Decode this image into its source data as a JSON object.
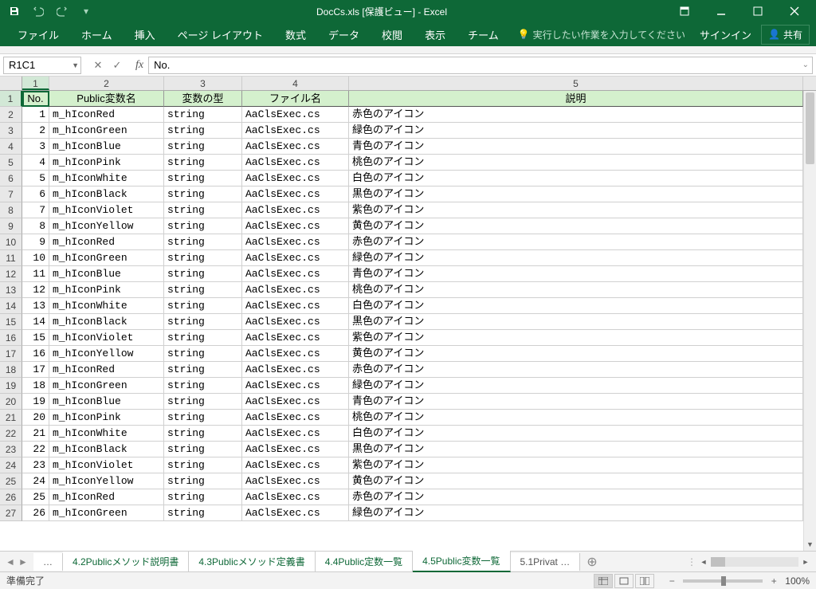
{
  "title": "DocCs.xls  [保護ビュー] - Excel",
  "ribbon": {
    "file": "ファイル",
    "home": "ホーム",
    "insert": "挿入",
    "pagelayout": "ページ レイアウト",
    "formulas": "数式",
    "data": "データ",
    "review": "校閲",
    "view": "表示",
    "team": "チーム",
    "tell": "実行したい作業を入力してください",
    "signin": "サインイン",
    "share": "共有"
  },
  "name_box": "R1C1",
  "formula": "No.",
  "col_headers": [
    "1",
    "2",
    "3",
    "4",
    "5"
  ],
  "headers": {
    "c1": "No.",
    "c2": "Public変数名",
    "c3": "変数の型",
    "c4": "ファイル名",
    "c5": "説明"
  },
  "rows": [
    {
      "n": "1",
      "v": "m_hIconRed",
      "t": "string",
      "f": "AaClsExec.cs",
      "d": "赤色のアイコン"
    },
    {
      "n": "2",
      "v": "m_hIconGreen",
      "t": "string",
      "f": "AaClsExec.cs",
      "d": "緑色のアイコン"
    },
    {
      "n": "3",
      "v": "m_hIconBlue",
      "t": "string",
      "f": "AaClsExec.cs",
      "d": "青色のアイコン"
    },
    {
      "n": "4",
      "v": "m_hIconPink",
      "t": "string",
      "f": "AaClsExec.cs",
      "d": "桃色のアイコン"
    },
    {
      "n": "5",
      "v": "m_hIconWhite",
      "t": "string",
      "f": "AaClsExec.cs",
      "d": "白色のアイコン"
    },
    {
      "n": "6",
      "v": "m_hIconBlack",
      "t": "string",
      "f": "AaClsExec.cs",
      "d": "黒色のアイコン"
    },
    {
      "n": "7",
      "v": "m_hIconViolet",
      "t": "string",
      "f": "AaClsExec.cs",
      "d": "紫色のアイコン"
    },
    {
      "n": "8",
      "v": "m_hIconYellow",
      "t": "string",
      "f": "AaClsExec.cs",
      "d": "黄色のアイコン"
    },
    {
      "n": "9",
      "v": "m_hIconRed",
      "t": "string",
      "f": "AaClsExec.cs",
      "d": "赤色のアイコン"
    },
    {
      "n": "10",
      "v": "m_hIconGreen",
      "t": "string",
      "f": "AaClsExec.cs",
      "d": "緑色のアイコン"
    },
    {
      "n": "11",
      "v": "m_hIconBlue",
      "t": "string",
      "f": "AaClsExec.cs",
      "d": "青色のアイコン"
    },
    {
      "n": "12",
      "v": "m_hIconPink",
      "t": "string",
      "f": "AaClsExec.cs",
      "d": "桃色のアイコン"
    },
    {
      "n": "13",
      "v": "m_hIconWhite",
      "t": "string",
      "f": "AaClsExec.cs",
      "d": "白色のアイコン"
    },
    {
      "n": "14",
      "v": "m_hIconBlack",
      "t": "string",
      "f": "AaClsExec.cs",
      "d": "黒色のアイコン"
    },
    {
      "n": "15",
      "v": "m_hIconViolet",
      "t": "string",
      "f": "AaClsExec.cs",
      "d": "紫色のアイコン"
    },
    {
      "n": "16",
      "v": "m_hIconYellow",
      "t": "string",
      "f": "AaClsExec.cs",
      "d": "黄色のアイコン"
    },
    {
      "n": "17",
      "v": "m_hIconRed",
      "t": "string",
      "f": "AaClsExec.cs",
      "d": "赤色のアイコン"
    },
    {
      "n": "18",
      "v": "m_hIconGreen",
      "t": "string",
      "f": "AaClsExec.cs",
      "d": "緑色のアイコン"
    },
    {
      "n": "19",
      "v": "m_hIconBlue",
      "t": "string",
      "f": "AaClsExec.cs",
      "d": "青色のアイコン"
    },
    {
      "n": "20",
      "v": "m_hIconPink",
      "t": "string",
      "f": "AaClsExec.cs",
      "d": "桃色のアイコン"
    },
    {
      "n": "21",
      "v": "m_hIconWhite",
      "t": "string",
      "f": "AaClsExec.cs",
      "d": "白色のアイコン"
    },
    {
      "n": "22",
      "v": "m_hIconBlack",
      "t": "string",
      "f": "AaClsExec.cs",
      "d": "黒色のアイコン"
    },
    {
      "n": "23",
      "v": "m_hIconViolet",
      "t": "string",
      "f": "AaClsExec.cs",
      "d": "紫色のアイコン"
    },
    {
      "n": "24",
      "v": "m_hIconYellow",
      "t": "string",
      "f": "AaClsExec.cs",
      "d": "黄色のアイコン"
    },
    {
      "n": "25",
      "v": "m_hIconRed",
      "t": "string",
      "f": "AaClsExec.cs",
      "d": "赤色のアイコン"
    },
    {
      "n": "26",
      "v": "m_hIconGreen",
      "t": "string",
      "f": "AaClsExec.cs",
      "d": "緑色のアイコン"
    }
  ],
  "sheet_tabs": {
    "more": "…",
    "t1": "4.2Publicメソッド説明書",
    "t2": "4.3Publicメソッド定義書",
    "t3": "4.4Public定数一覧",
    "t4": "4.5Public変数一覧",
    "t5": "5.1Privat",
    "t5s": "…"
  },
  "status": {
    "ready": "準備完了",
    "zoom": "100%"
  }
}
